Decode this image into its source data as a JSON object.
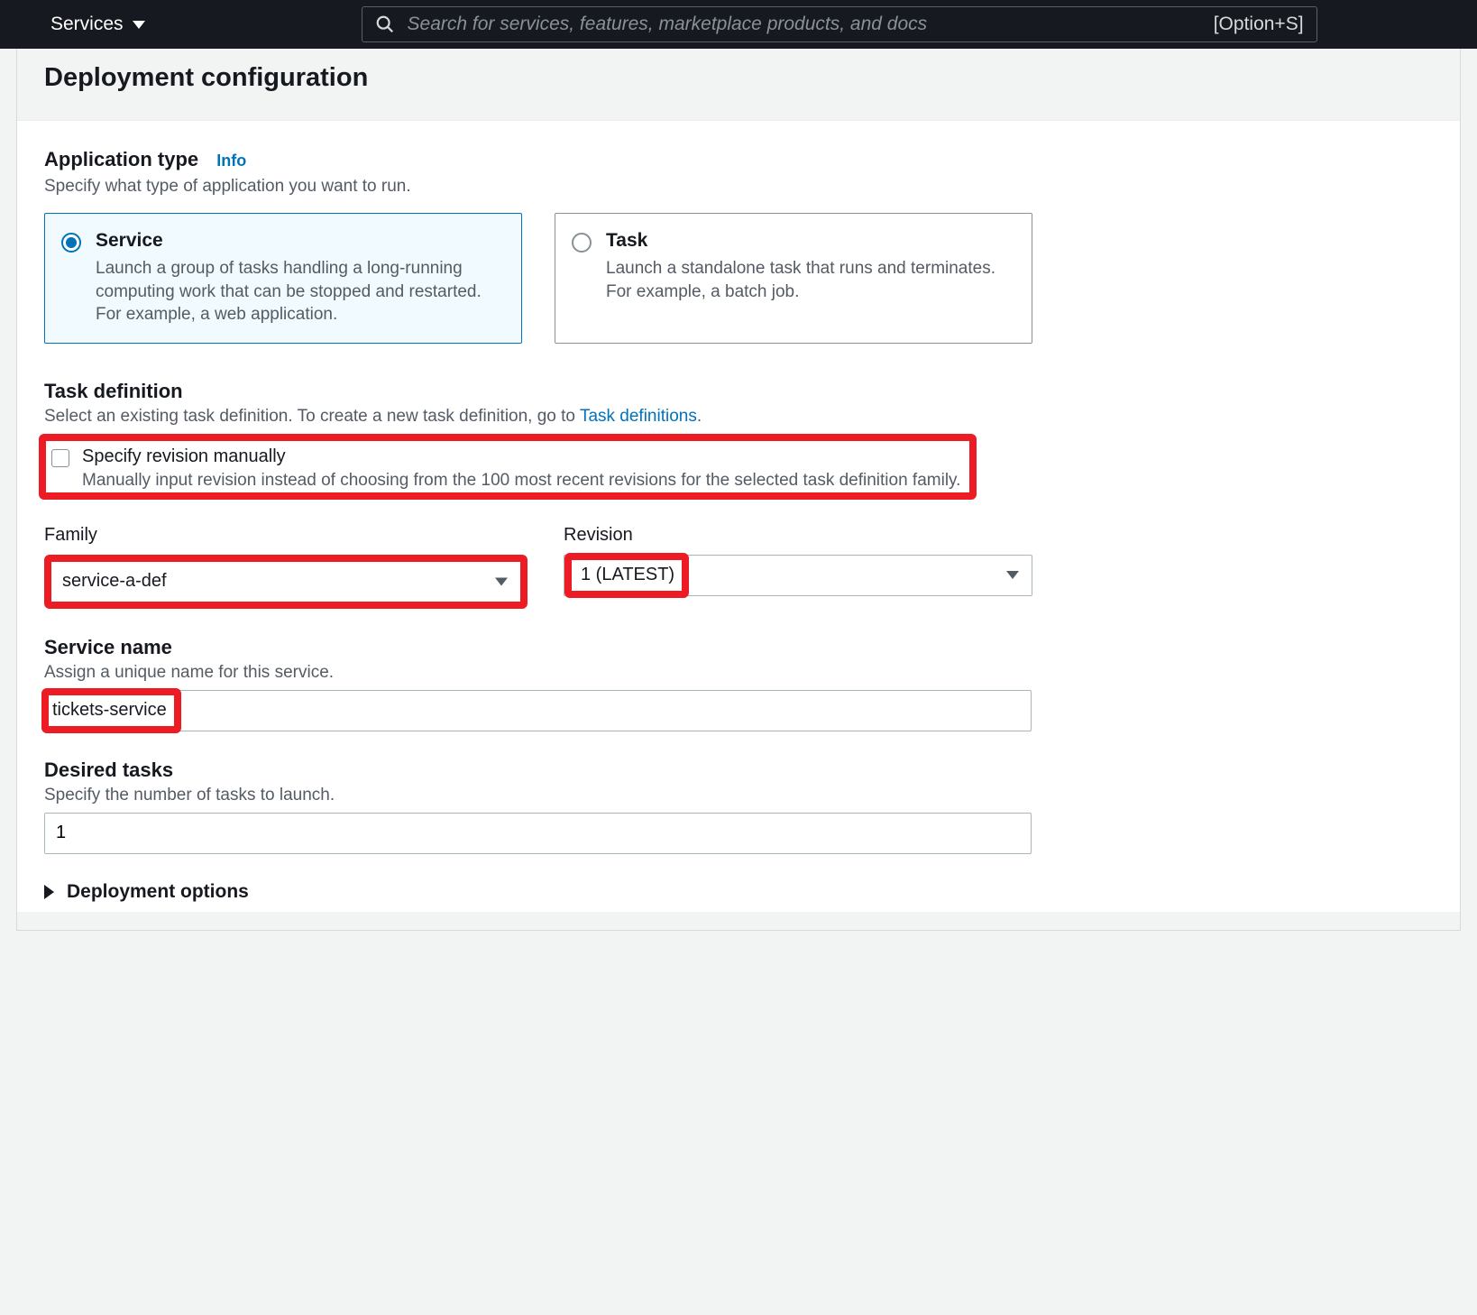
{
  "topnav": {
    "services_label": "Services",
    "search_placeholder": "Search for services, features, marketplace products, and docs",
    "shortcut": "[Option+S]"
  },
  "header": {
    "title": "Deployment configuration"
  },
  "app_type": {
    "title": "Application type",
    "info": "Info",
    "hint": "Specify what type of application you want to run.",
    "tiles": [
      {
        "title": "Service",
        "desc": "Launch a group of tasks handling a long-running computing work that can be stopped and restarted. For example, a web application.",
        "selected": true
      },
      {
        "title": "Task",
        "desc": "Launch a standalone task that runs and terminates. For example, a batch job.",
        "selected": false
      }
    ]
  },
  "task_def": {
    "title": "Task definition",
    "hint_pre": "Select an existing task definition. To create a new task definition, go to ",
    "hint_link": "Task definitions",
    "hint_post": ".",
    "specify_label": "Specify revision manually",
    "specify_hint": "Manually input revision instead of choosing from the 100 most recent revisions for the selected task definition family.",
    "family_label": "Family",
    "family_value": "service-a-def",
    "revision_label": "Revision",
    "revision_value": "1 (LATEST)"
  },
  "service_name": {
    "title": "Service name",
    "hint": "Assign a unique name for this service.",
    "value": "tickets-service"
  },
  "desired": {
    "title": "Desired tasks",
    "hint": "Specify the number of tasks to launch.",
    "value": "1"
  },
  "deploy_options": {
    "label": "Deployment options"
  }
}
